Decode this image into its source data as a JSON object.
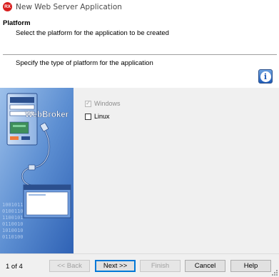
{
  "window": {
    "app_icon_text": "RX",
    "title": "New Web Server Application"
  },
  "header": {
    "title": "Platform",
    "subtitle": "Select the platform for the application to be created",
    "description": "Specify the type of platform for the application",
    "info_icon": "info-icon"
  },
  "side_image": {
    "label": "WebBroker",
    "binary_text": [
      "1001011",
      "0100110",
      "1100101",
      "0110010",
      "1010010",
      "0110100"
    ]
  },
  "platforms": [
    {
      "label": "Windows",
      "checked": true,
      "disabled": true
    },
    {
      "label": "Linux",
      "checked": false,
      "disabled": false
    }
  ],
  "footer": {
    "page_indicator": "1 of 4",
    "back_label": "<< Back",
    "next_label": "Next >>",
    "finish_label": "Finish",
    "cancel_label": "Cancel",
    "help_label": "Help"
  }
}
